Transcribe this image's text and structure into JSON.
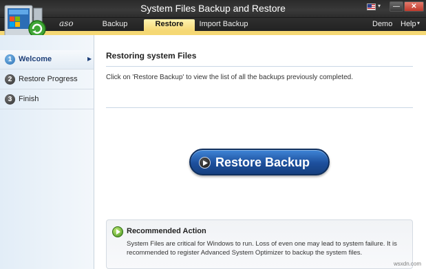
{
  "window": {
    "title": "System Files Backup and Restore",
    "brand": "aso"
  },
  "menu": {
    "tabs": [
      {
        "label": "Backup"
      },
      {
        "label": "Restore"
      },
      {
        "label": "Import Backup"
      }
    ],
    "active_tab": "Restore",
    "demo_label": "Demo",
    "help_label": "Help"
  },
  "sidebar": {
    "items": [
      {
        "num": "1",
        "label": "Welcome"
      },
      {
        "num": "2",
        "label": "Restore Progress"
      },
      {
        "num": "3",
        "label": "Finish"
      }
    ],
    "active_item": "Welcome"
  },
  "main": {
    "heading": "Restoring system Files",
    "description": "Click on 'Restore Backup' to view the list of all the backups previously completed.",
    "restore_button_label": "Restore Backup",
    "recommended": {
      "title": "Recommended Action",
      "line1": "System Files are critical for Windows to run. Loss of even one may lead to system failure. It is",
      "line2": "recommended to register Advanced System Optimizer to backup the system files."
    }
  },
  "watermark": "wsxdn.com",
  "colors": {
    "accent_yellow": "#f5d874",
    "button_blue": "#1d4f9c",
    "titlebar_dark": "#2a2a2a",
    "close_red": "#c0392b"
  },
  "icons": [
    "app-logo-icon",
    "us-flag-icon",
    "minimize-icon",
    "close-icon",
    "play-icon",
    "recommend-arrow-icon",
    "chevron-right-icon"
  ]
}
